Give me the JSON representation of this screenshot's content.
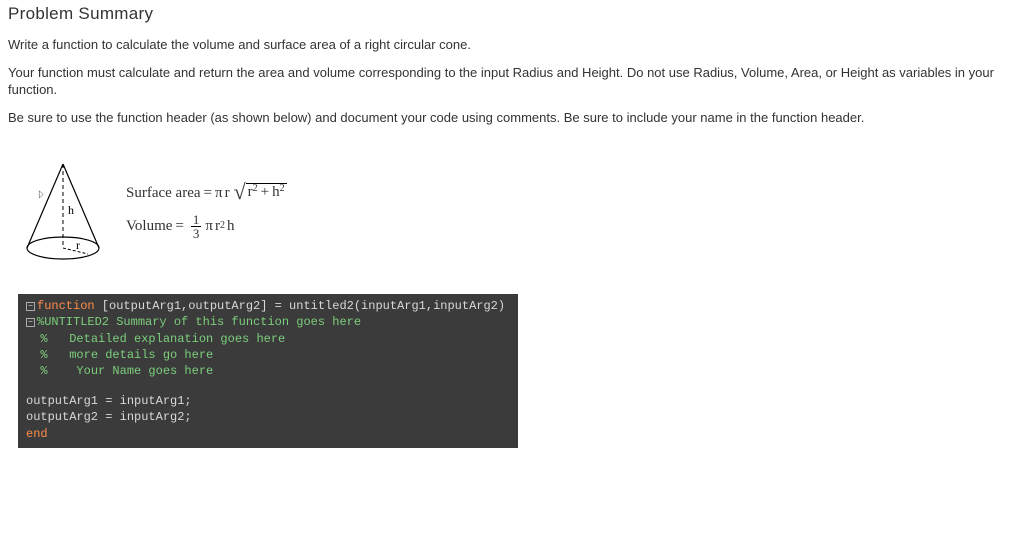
{
  "heading": "Problem Summary",
  "p1": "Write a function to calculate the volume and surface area of a right circular cone.",
  "p2": "Your function must calculate and return the area and volume corresponding to the input Radius and Height.  Do not use Radius, Volume, Area, or Height as variables in your function.",
  "p3": "Be sure to use the function header (as shown below) and document your code using comments.  Be sure to include your name in the function header.",
  "diagram": {
    "h_label": "h",
    "r_label": "r"
  },
  "formula": {
    "surface_label": "Surface area",
    "volume_label": "Volume",
    "eq": "=",
    "pi": "π",
    "r": "r",
    "h": "h",
    "exp2": "2",
    "plus": "+",
    "one": "1",
    "three": "3"
  },
  "code": {
    "fn_keyword": "function",
    "sig": " [outputArg1,outputArg2] = untitled2(inputArg1,inputArg2)",
    "c1": "%UNTITLED2 Summary of this function goes here",
    "c2": "%   Detailed explanation goes here",
    "c3": "%   more details go here",
    "c4": "%    Your Name goes here",
    "body1": "outputArg1 = inputArg1;",
    "body2": "outputArg2 = inputArg2;",
    "end": "end"
  }
}
